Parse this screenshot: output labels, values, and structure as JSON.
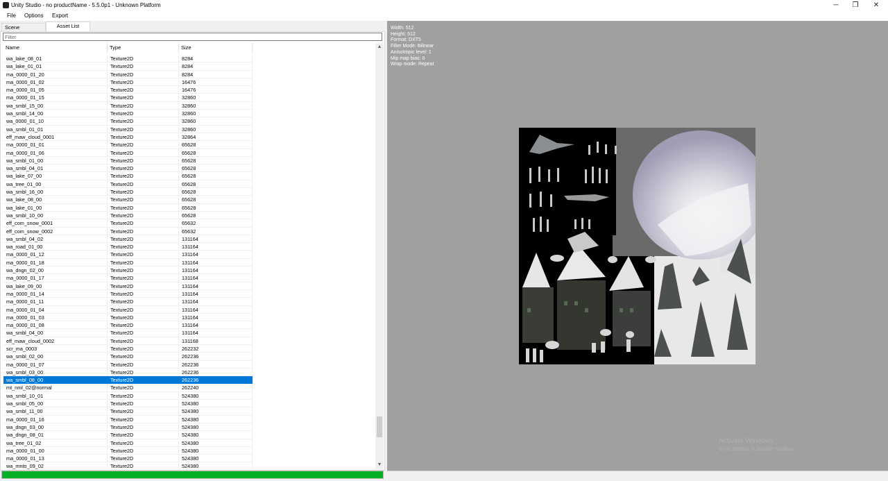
{
  "window": {
    "title": "Unity Studio - no productName - 5.5.0p1 - Unknown Platform",
    "minimize_glyph": "─",
    "maximize_glyph": "❐",
    "close_glyph": "✕"
  },
  "menu": {
    "file": "File",
    "options": "Options",
    "export": "Export"
  },
  "tabs": {
    "scene_hierarchy": "Scene Hierarchy",
    "asset_list": "Asset List"
  },
  "filter": {
    "placeholder": "Filter",
    "value": ""
  },
  "list": {
    "headers": {
      "name": "Name",
      "type": "Type",
      "size": "Size"
    },
    "rows": [
      {
        "name": "wa_lake_08_01",
        "type": "Texture2D",
        "size": "8284"
      },
      {
        "name": "wa_lake_01_01",
        "type": "Texture2D",
        "size": "8284"
      },
      {
        "name": "ma_0000_01_20",
        "type": "Texture2D",
        "size": "8284"
      },
      {
        "name": "ma_0000_01_02",
        "type": "Texture2D",
        "size": "16476"
      },
      {
        "name": "ma_0000_01_05",
        "type": "Texture2D",
        "size": "16476"
      },
      {
        "name": "ma_0000_01_15",
        "type": "Texture2D",
        "size": "32860"
      },
      {
        "name": "wa_smbl_15_00",
        "type": "Texture2D",
        "size": "32860"
      },
      {
        "name": "wa_smbl_14_00",
        "type": "Texture2D",
        "size": "32860"
      },
      {
        "name": "wa_0000_01_10",
        "type": "Texture2D",
        "size": "32860"
      },
      {
        "name": "wa_smbl_01_01",
        "type": "Texture2D",
        "size": "32860"
      },
      {
        "name": "eff_maw_cloud_0001",
        "type": "Texture2D",
        "size": "32864"
      },
      {
        "name": "ma_0000_01_01",
        "type": "Texture2D",
        "size": "65628"
      },
      {
        "name": "ma_0000_01_06",
        "type": "Texture2D",
        "size": "65628"
      },
      {
        "name": "wa_smbl_01_00",
        "type": "Texture2D",
        "size": "65628"
      },
      {
        "name": "wa_smbl_04_01",
        "type": "Texture2D",
        "size": "65628"
      },
      {
        "name": "wa_lake_07_00",
        "type": "Texture2D",
        "size": "65628"
      },
      {
        "name": "wa_tree_01_00",
        "type": "Texture2D",
        "size": "65628"
      },
      {
        "name": "wa_smbl_16_00",
        "type": "Texture2D",
        "size": "65628"
      },
      {
        "name": "wa_lake_08_00",
        "type": "Texture2D",
        "size": "65628"
      },
      {
        "name": "wa_lake_01_00",
        "type": "Texture2D",
        "size": "65628"
      },
      {
        "name": "wa_smbl_10_00",
        "type": "Texture2D",
        "size": "65628"
      },
      {
        "name": "eff_com_snow_0001",
        "type": "Texture2D",
        "size": "65632"
      },
      {
        "name": "eff_com_snow_0002",
        "type": "Texture2D",
        "size": "65632"
      },
      {
        "name": "wa_smbl_04_02",
        "type": "Texture2D",
        "size": "131164"
      },
      {
        "name": "wa_road_01_00",
        "type": "Texture2D",
        "size": "131164"
      },
      {
        "name": "ma_0000_01_12",
        "type": "Texture2D",
        "size": "131164"
      },
      {
        "name": "ma_0000_01_18",
        "type": "Texture2D",
        "size": "131164"
      },
      {
        "name": "wa_dngn_02_00",
        "type": "Texture2D",
        "size": "131164"
      },
      {
        "name": "ma_0000_01_17",
        "type": "Texture2D",
        "size": "131164"
      },
      {
        "name": "wa_lake_09_00",
        "type": "Texture2D",
        "size": "131164"
      },
      {
        "name": "ma_0000_01_14",
        "type": "Texture2D",
        "size": "131164"
      },
      {
        "name": "ma_0000_01_11",
        "type": "Texture2D",
        "size": "131164"
      },
      {
        "name": "ma_0000_01_04",
        "type": "Texture2D",
        "size": "131164"
      },
      {
        "name": "ma_0000_01_03",
        "type": "Texture2D",
        "size": "131164"
      },
      {
        "name": "ma_0000_01_08",
        "type": "Texture2D",
        "size": "131164"
      },
      {
        "name": "wa_smbl_04_00",
        "type": "Texture2D",
        "size": "131164"
      },
      {
        "name": "eff_maw_cloud_0002",
        "type": "Texture2D",
        "size": "131168"
      },
      {
        "name": "scr_ma_0003",
        "type": "Texture2D",
        "size": "262232"
      },
      {
        "name": "wa_smbl_02_00",
        "type": "Texture2D",
        "size": "262236"
      },
      {
        "name": "ma_0000_01_07",
        "type": "Texture2D",
        "size": "262236"
      },
      {
        "name": "wa_smbl_03_00",
        "type": "Texture2D",
        "size": "262236"
      },
      {
        "name": "wa_smbl_08_00",
        "type": "Texture2D",
        "size": "262236",
        "selected": true
      },
      {
        "name": "mt_nml_02@normal",
        "type": "Texture2D",
        "size": "262240"
      },
      {
        "name": "wa_smbl_10_01",
        "type": "Texture2D",
        "size": "524380"
      },
      {
        "name": "wa_smbl_05_00",
        "type": "Texture2D",
        "size": "524380"
      },
      {
        "name": "wa_smbl_11_00",
        "type": "Texture2D",
        "size": "524380"
      },
      {
        "name": "ma_0000_01_16",
        "type": "Texture2D",
        "size": "524380"
      },
      {
        "name": "wa_dngn_03_00",
        "type": "Texture2D",
        "size": "524380"
      },
      {
        "name": "wa_dngn_08_01",
        "type": "Texture2D",
        "size": "524380"
      },
      {
        "name": "wa_tree_01_02",
        "type": "Texture2D",
        "size": "524380"
      },
      {
        "name": "ma_0000_01_00",
        "type": "Texture2D",
        "size": "524380"
      },
      {
        "name": "ma_0000_01_13",
        "type": "Texture2D",
        "size": "524380"
      },
      {
        "name": "wa_mnto_09_02",
        "type": "Texture2D",
        "size": "524380"
      }
    ],
    "scroll_position": 0.94
  },
  "scroll": {
    "up_glyph": "▲",
    "down_glyph": "▼"
  },
  "progress": {
    "value": 1.0,
    "color": "#06b025"
  },
  "preview": {
    "info_lines": [
      "Width: 512",
      "Height: 512",
      "Format: DXT5",
      "Filter Mode: Bilinear",
      "Anisotropic level: 1",
      "Mip map bias: 0",
      "Wrap mode: Repeat"
    ],
    "watermark_line1": "Activate Windows",
    "watermark_line2": "Go to Settings to activate Windows."
  },
  "colors": {
    "selection": "#0078d7",
    "preview_bg": "#a0a0a0",
    "progress": "#06b025"
  }
}
